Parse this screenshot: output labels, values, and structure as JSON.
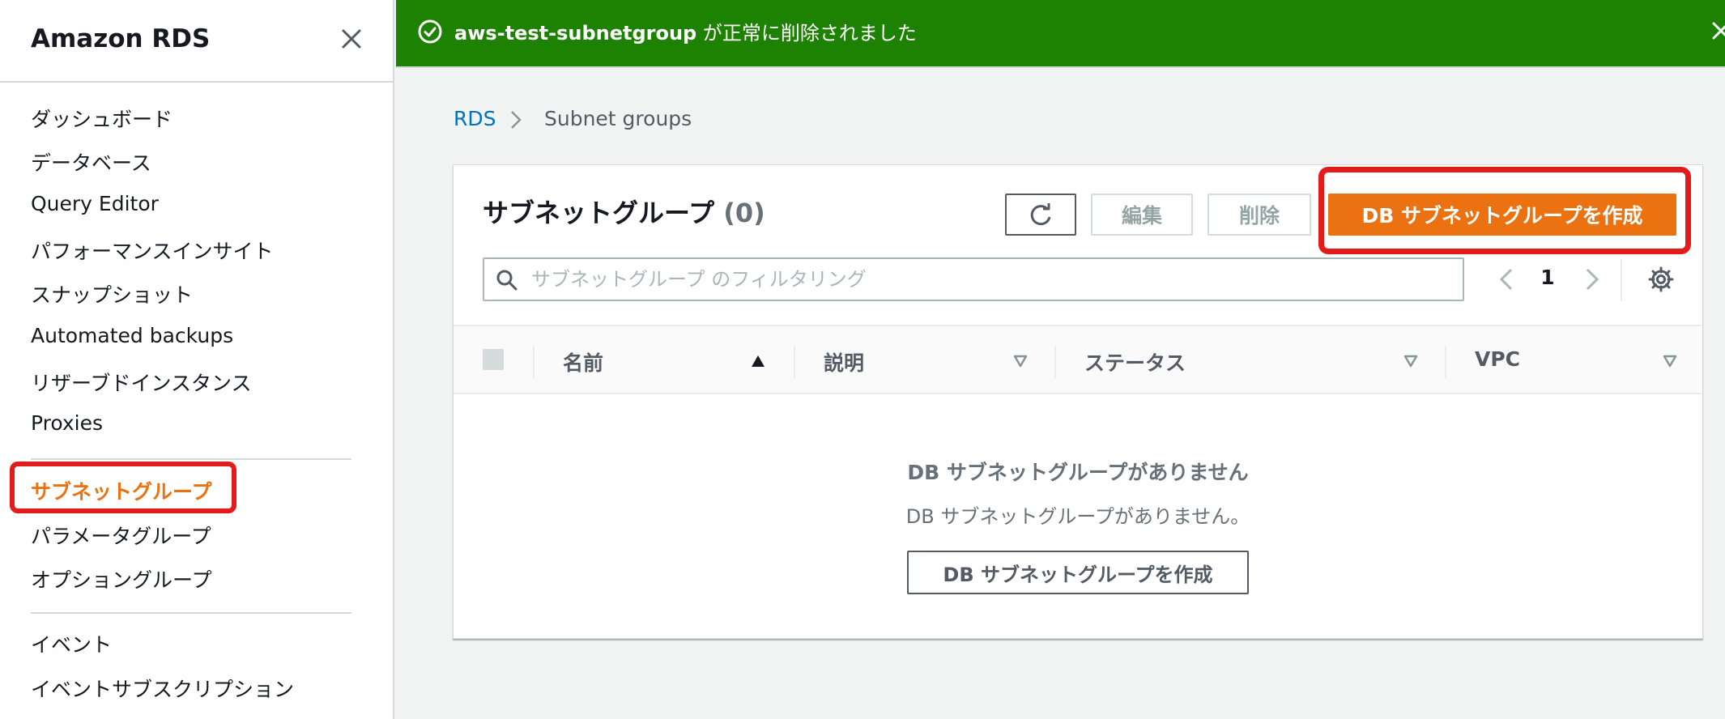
{
  "sidebar": {
    "title": "Amazon RDS",
    "items": [
      {
        "label": "ダッシュボード"
      },
      {
        "label": "データベース"
      },
      {
        "label": "Query Editor"
      },
      {
        "label": "パフォーマンスインサイト"
      },
      {
        "label": "スナップショット"
      },
      {
        "label": "Automated backups"
      },
      {
        "label": "リザーブドインスタンス"
      },
      {
        "label": "Proxies"
      },
      {
        "label": "サブネットグループ"
      },
      {
        "label": "パラメータグループ"
      },
      {
        "label": "オプショングループ"
      },
      {
        "label": "イベント"
      },
      {
        "label": "イベントサブスクリプション"
      }
    ],
    "active_item": "サブネットグループ"
  },
  "flash": {
    "resource": "aws-test-subnetgroup",
    "message": " が正常に削除されました"
  },
  "breadcrumb": {
    "root": "RDS",
    "current": "Subnet groups"
  },
  "panel": {
    "title": "サブネットグループ",
    "count": "(0)",
    "edit_label": "編集",
    "delete_label": "削除",
    "create_label": "DB サブネットグループを作成",
    "filter_placeholder": "サブネットグループ のフィルタリング",
    "page": "1"
  },
  "table": {
    "columns": [
      "名前",
      "説明",
      "ステータス",
      "VPC"
    ],
    "sorted_column": "名前",
    "empty_title": "DB サブネットグループがありません",
    "empty_description": "DB サブネットグループがありません。",
    "empty_create_label": "DB サブネットグループを作成"
  },
  "colors": {
    "accent": "#ec7211",
    "success": "#1d8102",
    "link": "#0073bb",
    "annotation": "#e41b1b"
  }
}
